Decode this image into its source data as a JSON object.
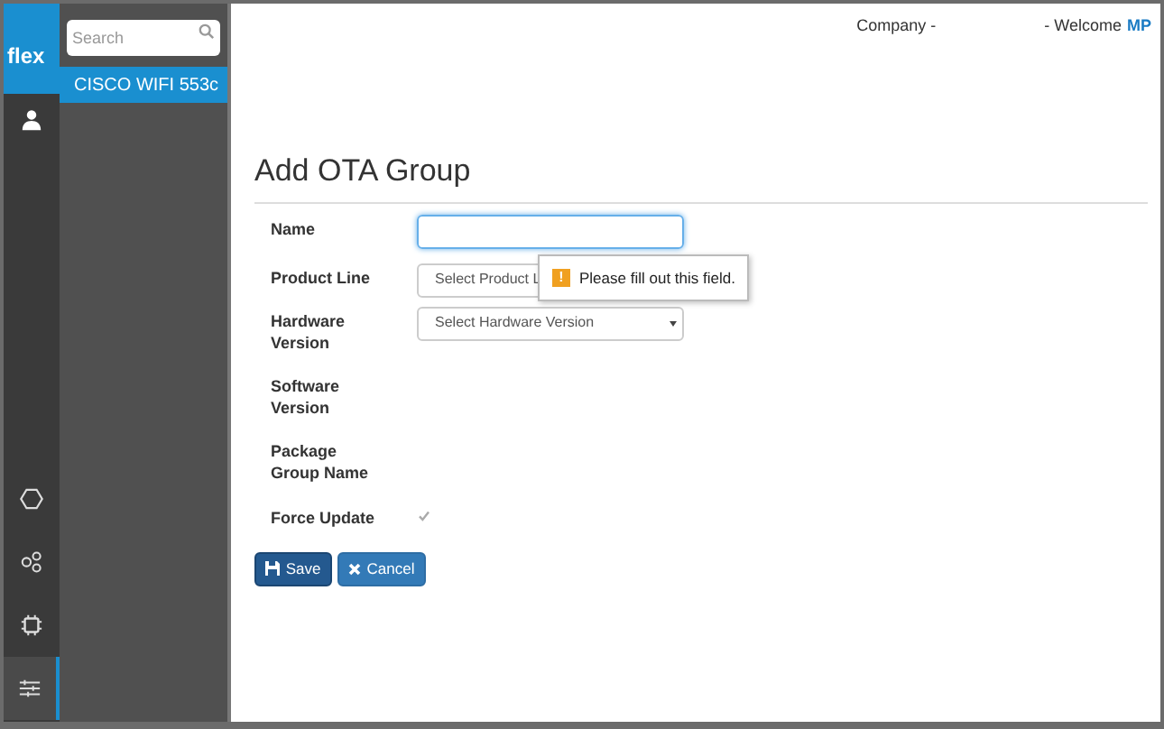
{
  "logo": "flex",
  "rail": [
    {
      "kind": "user",
      "selected": false
    },
    {
      "kind": "hexagon",
      "selected": false
    },
    {
      "kind": "circles",
      "selected": false
    },
    {
      "kind": "chip",
      "selected": false
    },
    {
      "kind": "sliders",
      "selected": true
    }
  ],
  "sidebar": {
    "search": {
      "placeholder": "Search"
    },
    "items": [
      {
        "label": "CISCO WIFI 553c",
        "selected": true
      }
    ]
  },
  "header": {
    "company": "Company -",
    "welcome": "- Welcome",
    "user": "MP"
  },
  "title": "Add OTA Group",
  "fields": [
    {
      "kind": "input",
      "label": "Name",
      "focused": true
    },
    {
      "kind": "select",
      "label": "Product Line",
      "value": "Select Product L"
    },
    {
      "kind": "select",
      "label": "Hardware Version",
      "value": "Select Hardware Version"
    },
    {
      "kind": "none",
      "label": "Software Version"
    },
    {
      "kind": "none",
      "label": "Package Group Name"
    },
    {
      "kind": "checkbox",
      "label": "Force Update",
      "checked": true
    }
  ],
  "tooltip": {
    "icon": "!",
    "text": "Please fill out this field."
  },
  "buttons": [
    {
      "kind": "save",
      "label": "Save"
    },
    {
      "kind": "cancel",
      "label": "Cancel"
    }
  ]
}
